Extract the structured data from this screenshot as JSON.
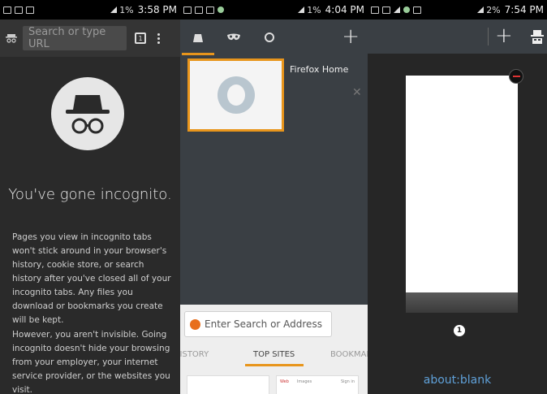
{
  "status_bars": [
    {
      "time": "3:58 PM",
      "battery": "1%"
    },
    {
      "time": "4:04 PM",
      "battery": "1%"
    },
    {
      "time": "7:54 PM",
      "battery": "2%"
    }
  ],
  "chrome_incognito": {
    "search_placeholder": "Search or type URL",
    "tab_count": "1",
    "title": "You've gone incognito.",
    "paragraph1": "Pages you view in incognito tabs won't stick around in your browser's history, cookie store, or search history after you've closed all of your incognito tabs. Any files you download or bookmarks you create will be kept.",
    "paragraph2": "However, you aren't invisible. Going incognito doesn't hide your browsing from your employer, your internet service provider, or the websites you visit."
  },
  "firefox_tabs": {
    "tab_label": "Firefox Home",
    "search_placeholder": "Enter Search or Address",
    "page_tabs": [
      "HISTORY",
      "TOP SITES",
      "BOOKMARKS"
    ],
    "tile2_texts": [
      "Web",
      "Images",
      "Sign in"
    ]
  },
  "stock_browser": {
    "tab_count": "1",
    "tab_label": "about:blank"
  },
  "colors": {
    "accent": "#e8951c",
    "link": "#5fa0d8"
  }
}
